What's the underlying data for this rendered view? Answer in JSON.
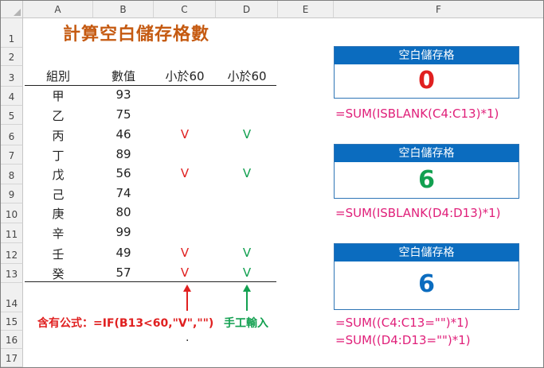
{
  "sheet": {
    "columns": [
      "A",
      "B",
      "C",
      "D",
      "E",
      "F"
    ],
    "rows": [
      "1",
      "2",
      "3",
      "4",
      "5",
      "6",
      "7",
      "8",
      "9",
      "10",
      "11",
      "12",
      "13",
      "14",
      "15",
      "16",
      "17"
    ]
  },
  "title": "計算空白儲存格數",
  "table": {
    "headers": [
      "組別",
      "數值",
      "小於60",
      "小於60"
    ],
    "rows": [
      {
        "group": "甲",
        "value": "93",
        "c": "",
        "d": ""
      },
      {
        "group": "乙",
        "value": "75",
        "c": "",
        "d": ""
      },
      {
        "group": "丙",
        "value": "46",
        "c": "V",
        "d": "V"
      },
      {
        "group": "丁",
        "value": "89",
        "c": "",
        "d": ""
      },
      {
        "group": "戊",
        "value": "56",
        "c": "V",
        "d": "V"
      },
      {
        "group": "己",
        "value": "74",
        "c": "",
        "d": ""
      },
      {
        "group": "庚",
        "value": "80",
        "c": "",
        "d": ""
      },
      {
        "group": "辛",
        "value": "99",
        "c": "",
        "d": ""
      },
      {
        "group": "壬",
        "value": "49",
        "c": "V",
        "d": "V"
      },
      {
        "group": "癸",
        "value": "57",
        "c": "V",
        "d": "V"
      }
    ]
  },
  "notes": {
    "formula_note": "含有公式：=IF(B13<60,\"V\",\"\")",
    "manual_note": "手工輸入",
    "dot": "."
  },
  "cards": [
    {
      "title": "空白儲存格",
      "value": "0",
      "color": "#e02020",
      "formula": "=SUM(ISBLANK(C4:C13)*1)"
    },
    {
      "title": "空白儲存格",
      "value": "6",
      "color": "#12a050",
      "formula": "=SUM(ISBLANK(D4:D13)*1)"
    },
    {
      "title": "空白儲存格",
      "value": "6",
      "color": "#0b6cbf",
      "formula": "=SUM((C4:C13=\"\")*1)",
      "formula2": "=SUM((D4:D13=\"\")*1)"
    }
  ],
  "colors": {
    "red_mark": "#e02020",
    "green_mark": "#12a050",
    "card_header": "#0b6cbf",
    "formula_text": "#e0207a",
    "title_text": "#c55a11"
  }
}
